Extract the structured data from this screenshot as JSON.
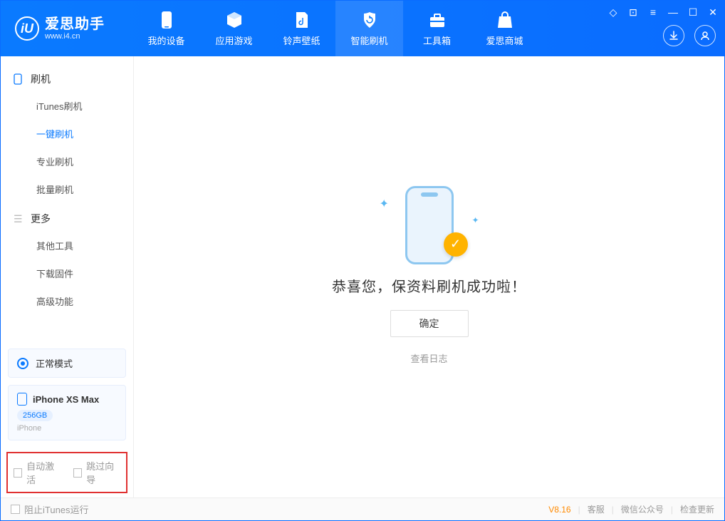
{
  "app": {
    "logo_title": "爱思助手",
    "logo_sub": "www.i4.cn"
  },
  "top_tabs": [
    {
      "label": "我的设备",
      "icon": "phone"
    },
    {
      "label": "应用游戏",
      "icon": "cube"
    },
    {
      "label": "铃声壁纸",
      "icon": "music"
    },
    {
      "label": "智能刷机",
      "icon": "shield",
      "active": true
    },
    {
      "label": "工具箱",
      "icon": "toolbox"
    },
    {
      "label": "爱思商城",
      "icon": "bag"
    }
  ],
  "sidebar": {
    "groups": [
      {
        "title": "刷机",
        "icon": "phone",
        "items": [
          {
            "label": "iTunes刷机"
          },
          {
            "label": "一键刷机",
            "active": true
          },
          {
            "label": "专业刷机"
          },
          {
            "label": "批量刷机"
          }
        ]
      },
      {
        "title": "更多",
        "icon": "menu",
        "items": [
          {
            "label": "其他工具"
          },
          {
            "label": "下载固件"
          },
          {
            "label": "高级功能"
          }
        ]
      }
    ],
    "mode_label": "正常模式",
    "device": {
      "name": "iPhone XS Max",
      "capacity": "256GB",
      "type": "iPhone"
    },
    "checkboxes": {
      "auto_activate": "自动激活",
      "skip_guide": "跳过向导"
    }
  },
  "content": {
    "success_msg": "恭喜您，保资料刷机成功啦！",
    "ok_button": "确定",
    "log_link": "查看日志"
  },
  "statusbar": {
    "block_itunes": "阻止iTunes运行",
    "version": "V8.16",
    "links": [
      "客服",
      "微信公众号",
      "检查更新"
    ]
  }
}
